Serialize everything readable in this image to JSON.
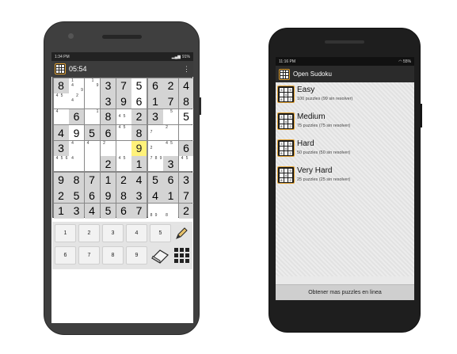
{
  "game_screen": {
    "status": {
      "time": "1:34 PM",
      "battery": "91%"
    },
    "title": {
      "timer": "05:54",
      "menu": "⋮"
    },
    "grid_rows": [
      [
        {
          "v": "8",
          "g": 1
        },
        {
          "n": [
            "1",
            "",
            "",
            "4",
            "",
            "",
            "",
            "",
            "9"
          ]
        },
        {
          "n": [
            "",
            "1",
            "",
            "",
            "",
            "9"
          ]
        },
        {
          "v": "3",
          "g": 1
        },
        {
          "v": "7",
          "g": 1
        },
        {
          "v": "5",
          "g": 0
        },
        {
          "v": "6",
          "g": 1
        },
        {
          "v": "2",
          "g": 1
        },
        {
          "v": "4",
          "g": 1
        }
      ],
      [
        {
          "n": [
            "4",
            "5",
            "",
            "",
            "",
            "",
            "",
            "",
            ""
          ]
        },
        {
          "n": [
            "",
            "2",
            "",
            "4",
            "",
            "",
            ""
          ]
        },
        {
          "n": [
            "",
            "",
            "",
            "",
            "",
            "",
            "",
            "",
            ""
          ]
        },
        {
          "v": "3",
          "g": 1
        },
        {
          "v": "9",
          "g": 1
        },
        {
          "v": "6",
          "g": 0
        },
        {
          "v": "1",
          "g": 1
        },
        {
          "v": "7",
          "g": 1
        },
        {
          "v": "8",
          "g": 1
        }
      ],
      [
        {
          "n": [
            "4",
            "",
            "",
            "",
            "",
            "",
            "",
            "",
            ""
          ]
        },
        {
          "v": "6",
          "g": 1
        },
        {
          "n": [
            "",
            "",
            "1",
            "",
            "",
            "",
            "",
            "",
            ""
          ]
        },
        {
          "v": "8",
          "g": 1
        },
        {
          "n": [
            "",
            "",
            "",
            "4",
            "5",
            "",
            "",
            "",
            ""
          ]
        },
        {
          "v": "2",
          "g": 1
        },
        {
          "v": "3",
          "g": 1
        },
        {
          "n": [
            "",
            "5",
            "",
            "",
            "",
            "",
            "",
            "",
            ""
          ]
        },
        {
          "v": "5",
          "g": 0
        }
      ],
      [
        {
          "v": "4",
          "g": 1
        },
        {
          "v": "9",
          "g": 0
        },
        {
          "v": "5",
          "g": 1
        },
        {
          "v": "6",
          "g": 1
        },
        {
          "n": [
            "4",
            "5",
            "",
            "",
            "",
            "",
            "",
            "",
            ""
          ]
        },
        {
          "v": "8",
          "g": 1
        },
        {
          "n": [
            "",
            "",
            "",
            "7",
            "",
            "",
            "",
            "",
            ""
          ]
        },
        {
          "n": [
            "2",
            "",
            "",
            "",
            "",
            "",
            "",
            "",
            ""
          ]
        },
        {
          "n": [
            "",
            "",
            "",
            "",
            "",
            "",
            "",
            "",
            ""
          ]
        }
      ],
      [
        {
          "v": "3",
          "g": 1
        },
        {
          "n": [
            "4",
            "",
            "",
            "",
            "",
            "",
            "",
            "",
            ""
          ]
        },
        {
          "n": [
            "4",
            "",
            "",
            "",
            "",
            "",
            "",
            "",
            ""
          ]
        },
        {
          "n": [
            "2",
            "",
            "",
            "",
            "",
            "",
            "",
            "",
            ""
          ]
        },
        {
          "v": "",
          "g": 0
        },
        {
          "v": "9",
          "sel": 1
        },
        {
          "n": [
            "",
            "",
            "",
            "2",
            "",
            "",
            "",
            "",
            ""
          ]
        },
        {
          "n": [
            "4",
            "5",
            "",
            "",
            "",
            "",
            "",
            "",
            ""
          ]
        },
        {
          "v": "6",
          "g": 1
        }
      ],
      [
        {
          "n": [
            "4",
            "5",
            "6",
            "",
            "",
            "",
            "",
            "",
            ""
          ]
        },
        {
          "n": [
            "4",
            "",
            "",
            "",
            "",
            "",
            "",
            "",
            ""
          ]
        },
        {
          "n": [
            "",
            "",
            "",
            "",
            "",
            "",
            "",
            "",
            ""
          ]
        },
        {
          "v": "2",
          "g": 1
        },
        {
          "n": [
            "4",
            "5",
            "",
            "",
            "",
            "",
            "",
            "",
            ""
          ]
        },
        {
          "v": "1",
          "g": 1
        },
        {
          "n": [
            "7",
            "8",
            "9",
            "",
            "",
            "",
            "",
            "",
            ""
          ]
        },
        {
          "v": "3",
          "g": 1
        },
        {
          "n": [
            "4",
            "5",
            "",
            "",
            "",
            "",
            "",
            "",
            ""
          ]
        }
      ],
      [
        {
          "v": "9",
          "g": 1
        },
        {
          "v": "8",
          "g": 1
        },
        {
          "v": "7",
          "g": 1
        },
        {
          "v": "1",
          "g": 1
        },
        {
          "v": "2",
          "g": 1
        },
        {
          "v": "4",
          "g": 1
        },
        {
          "v": "5",
          "g": 1
        },
        {
          "v": "6",
          "g": 1
        },
        {
          "v": "3",
          "g": 1
        }
      ],
      [
        {
          "v": "2",
          "g": 1
        },
        {
          "v": "5",
          "g": 1
        },
        {
          "v": "6",
          "g": 1
        },
        {
          "v": "9",
          "g": 1
        },
        {
          "v": "8",
          "g": 1
        },
        {
          "v": "3",
          "g": 1
        },
        {
          "v": "4",
          "g": 1
        },
        {
          "v": "1",
          "g": 1
        },
        {
          "v": "7",
          "g": 1
        }
      ],
      [
        {
          "v": "1",
          "g": 1
        },
        {
          "v": "3",
          "g": 1
        },
        {
          "v": "4",
          "g": 1
        },
        {
          "v": "5",
          "g": 1
        },
        {
          "v": "6",
          "g": 1
        },
        {
          "v": "7",
          "g": 1
        },
        {
          "n": [
            "",
            "",
            "",
            "",
            "",
            "",
            "8",
            "9",
            ""
          ]
        },
        {
          "n": [
            "",
            "",
            "",
            "",
            "",
            "",
            "8",
            "",
            ""
          ]
        },
        {
          "v": "2",
          "g": 1
        }
      ]
    ],
    "keypad": {
      "row1": [
        "1",
        "2",
        "3",
        "4",
        "5"
      ],
      "row2": [
        "6",
        "7",
        "8",
        "9"
      ]
    },
    "tool_icons": [
      "pencil-icon",
      "eraser-icon",
      "grid-icon"
    ]
  },
  "list_screen": {
    "status": {
      "time": "11:16 PM",
      "battery": "55%"
    },
    "title": "Open Sudoku",
    "folders": [
      {
        "name": "Easy",
        "detail": "100 puzzles (99 sin resolver)"
      },
      {
        "name": "Medium",
        "detail": "75 puzzles (75 sin resolver)"
      },
      {
        "name": "Hard",
        "detail": "50 puzzles (50 sin resolver)"
      },
      {
        "name": "Very Hard",
        "detail": "25 puzzles (25 sin resolver)"
      }
    ],
    "get_more": "Obtener mas puzzles en linea"
  }
}
